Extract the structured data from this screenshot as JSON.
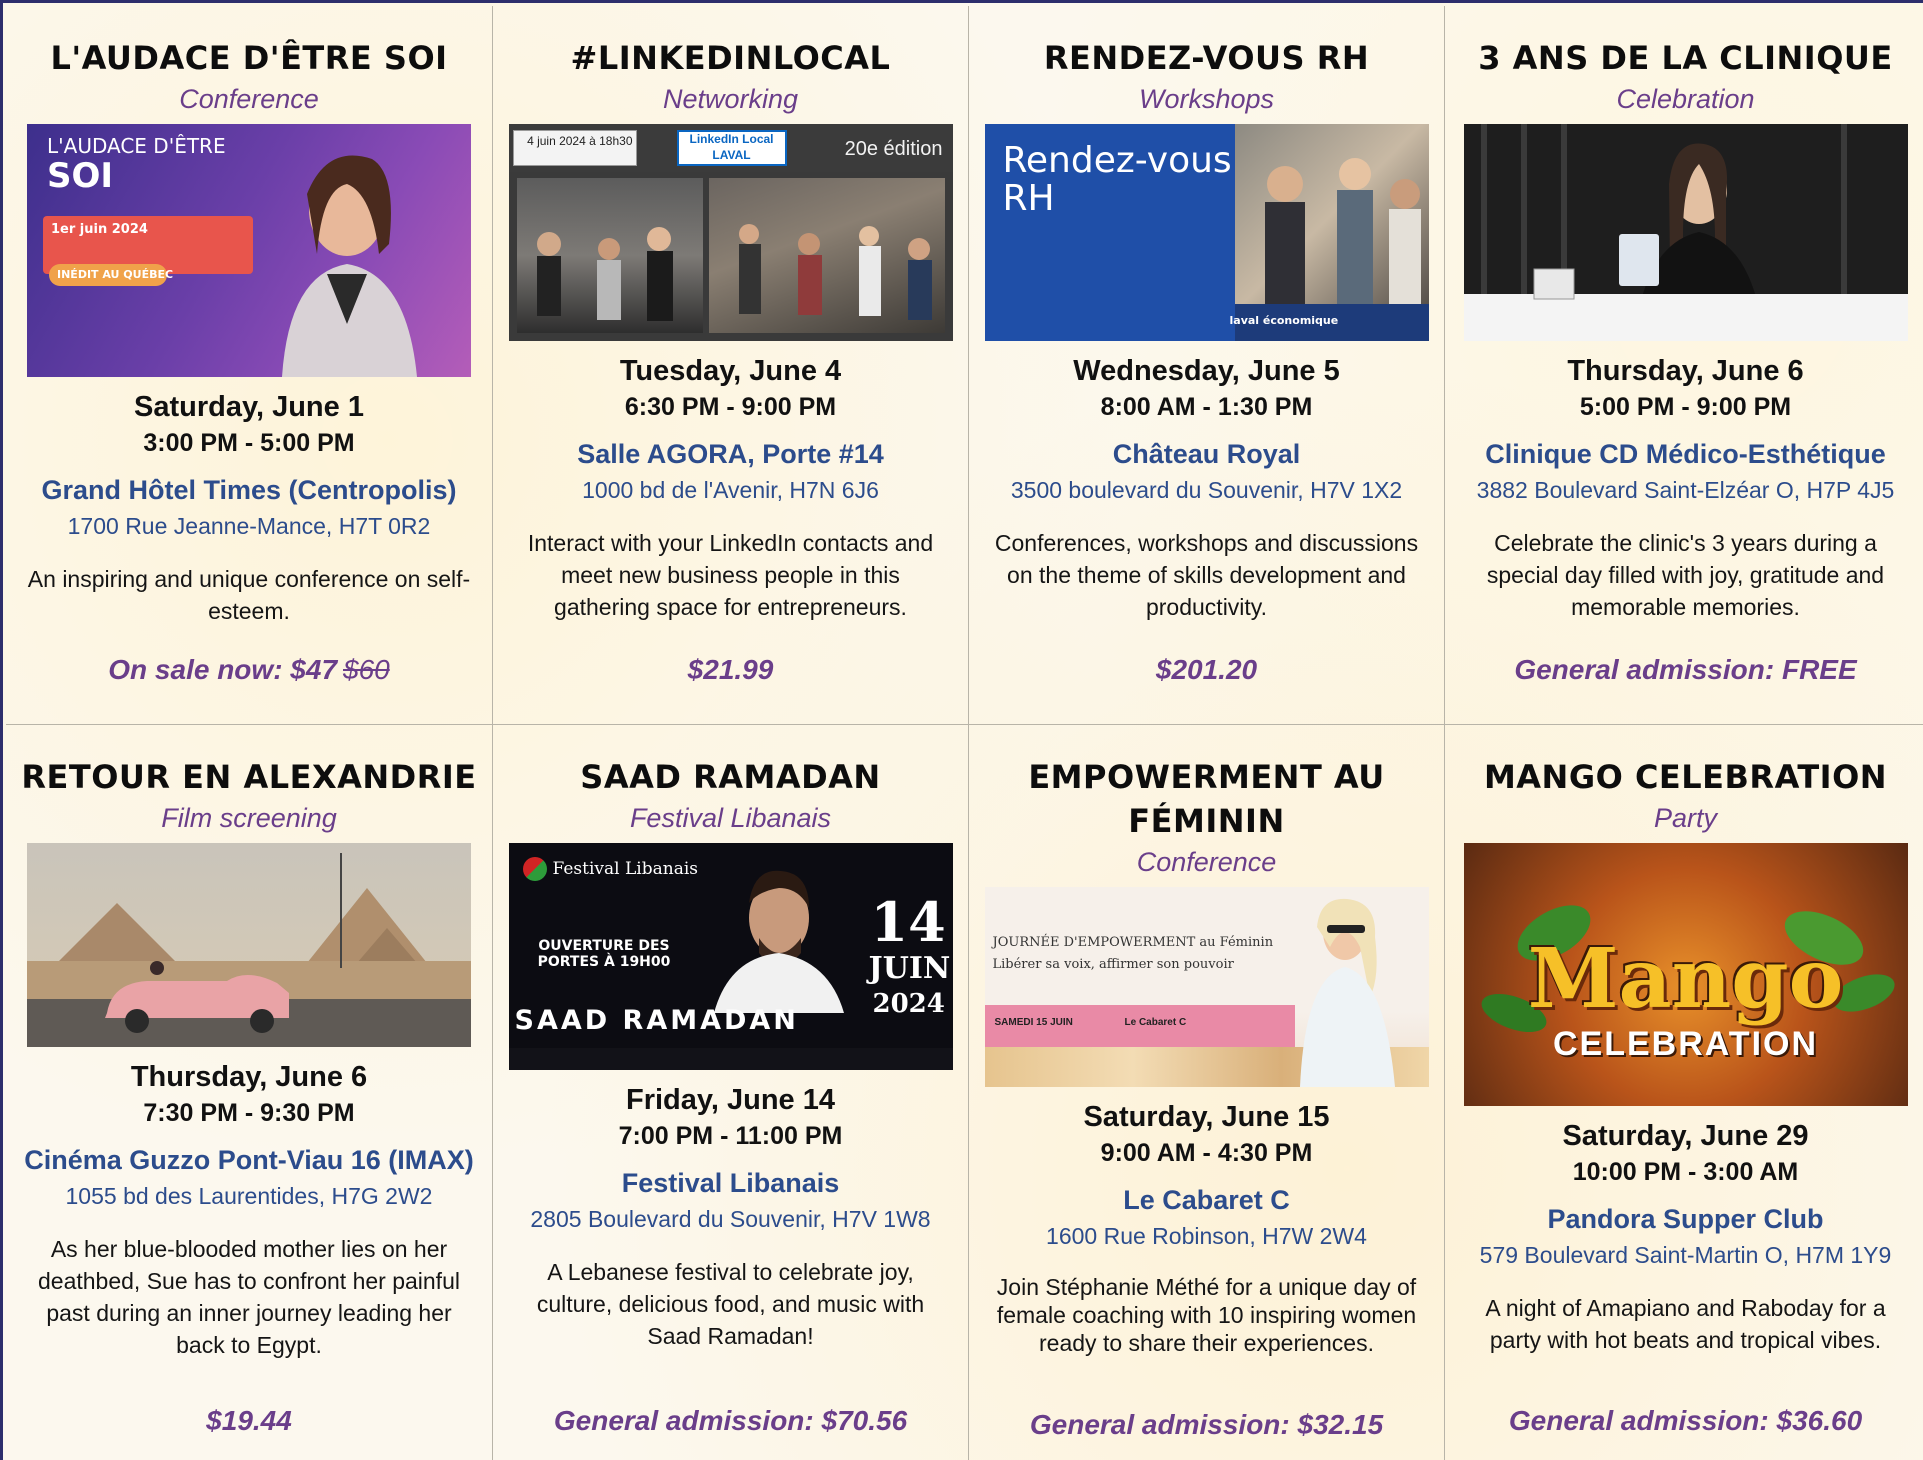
{
  "events": [
    {
      "title": "L'AUDACE D'ÊTRE SOI",
      "category": "Conference",
      "image": {
        "line1": "L'AUDACE D'ÊTRE",
        "line2": "SOI",
        "line3": "1er juin 2024",
        "line4": "INÉDIT AU QUÉBEC"
      },
      "date": "Saturday, June 1",
      "time": "3:00 PM - 5:00 PM",
      "venue": "Grand Hôtel Times (Centropolis)",
      "address": "1700 Rue Jeanne-Mance, H7T 0R2",
      "description": "An inspiring and unique conference on self-esteem.",
      "price": "On sale now: $47",
      "price_old": "$60"
    },
    {
      "title": "#LINKEDINLOCAL",
      "category": "Networking",
      "image": {
        "date": "4 juin 2024 à 18h30",
        "logo": "LinkedIn Local LAVAL",
        "edition": "20e édition"
      },
      "date": "Tuesday, June 4",
      "time": "6:30 PM - 9:00 PM",
      "venue": "Salle AGORA, Porte #14",
      "address": "1000 bd de l'Avenir, H7N 6J6",
      "description": "Interact with your LinkedIn contacts and meet new business people in this gathering space for entrepreneurs.",
      "price": "$21.99"
    },
    {
      "title": "RENDEZ-VOUS RH",
      "category": "Workshops",
      "image": {
        "line1": "Rendez-vous",
        "line2": "RH",
        "footer": "laval économique"
      },
      "date": "Wednesday, June 5",
      "time": "8:00 AM - 1:30 PM",
      "venue": "Château Royal",
      "address": "3500 boulevard du Souvenir, H7V 1X2",
      "description": "Conferences, workshops and discussions on the theme of skills development and productivity.",
      "price": "$201.20"
    },
    {
      "title": "3 ANS DE LA CLINIQUE",
      "category": "Celebration",
      "date": "Thursday, June 6",
      "time": "5:00 PM - 9:00 PM",
      "venue": "Clinique CD Médico-Esthétique",
      "address": "3882 Boulevard Saint-Elzéar O, H7P 4J5",
      "description": "Celebrate the clinic's 3 years during a special day filled with joy, gratitude and memorable memories.",
      "price": "General admission: FREE"
    },
    {
      "title": "RETOUR EN ALEXANDRIE",
      "category": "Film screening",
      "date": "Thursday, June 6",
      "time": "7:30 PM - 9:30 PM",
      "venue": "Cinéma Guzzo Pont-Viau 16 (IMAX)",
      "address": "1055 bd des Laurentides, H7G 2W2",
      "description": "As her blue-blooded mother lies on her deathbed, Sue has to confront her painful past during an inner journey leading her back to Egypt.",
      "price": "$19.44"
    },
    {
      "title": "SAAD RAMADAN",
      "category": "Festival Libanais",
      "image": {
        "brand": "Festival Libanais",
        "doors": "OUVERTURE DES PORTES À 19H00",
        "name": "SAAD RAMADAN",
        "day": "14",
        "month": "JUIN",
        "year": "2024"
      },
      "date": "Friday, June 14",
      "time": "7:00 PM - 11:00 PM",
      "venue": "Festival Libanais",
      "address": "2805 Boulevard du Souvenir, H7V 1W8",
      "description": "A Lebanese festival to celebrate joy, culture, delicious food, and music with Saad Ramadan!",
      "price": "General admission: $70.56"
    },
    {
      "title": "EMPOWERMENT AU FÉMININ",
      "category": "Conference",
      "image": {
        "line1": "JOURNÉE D'EMPOWERMENT au Féminin",
        "line2": "Libérer sa voix, affirmer son pouvoir",
        "badge1": "SAMEDI 15 JUIN",
        "badge2": "Le Cabaret C"
      },
      "date": "Saturday, June 15",
      "time": "9:00 AM - 4:30 PM",
      "venue": "Le Cabaret C",
      "address": "1600 Rue Robinson, H7W 2W4",
      "description": "Join Stéphanie Méthé for a unique day of female coaching with 10 inspiring women ready to share their experiences.",
      "price": "General admission: $32.15"
    },
    {
      "title": "MANGO CELEBRATION",
      "category": "Party",
      "image": {
        "line1": "Mango",
        "line2": "CELEBRATION"
      },
      "date": "Saturday, June 29",
      "time": "10:00 PM - 3:00 AM",
      "venue": "Pandora Supper Club",
      "address": "579 Boulevard Saint-Martin O, H7M 1Y9",
      "description": "A night of Amapiano and Raboday for a party with hot beats and tropical vibes.",
      "price": "General admission: $36.60"
    }
  ]
}
